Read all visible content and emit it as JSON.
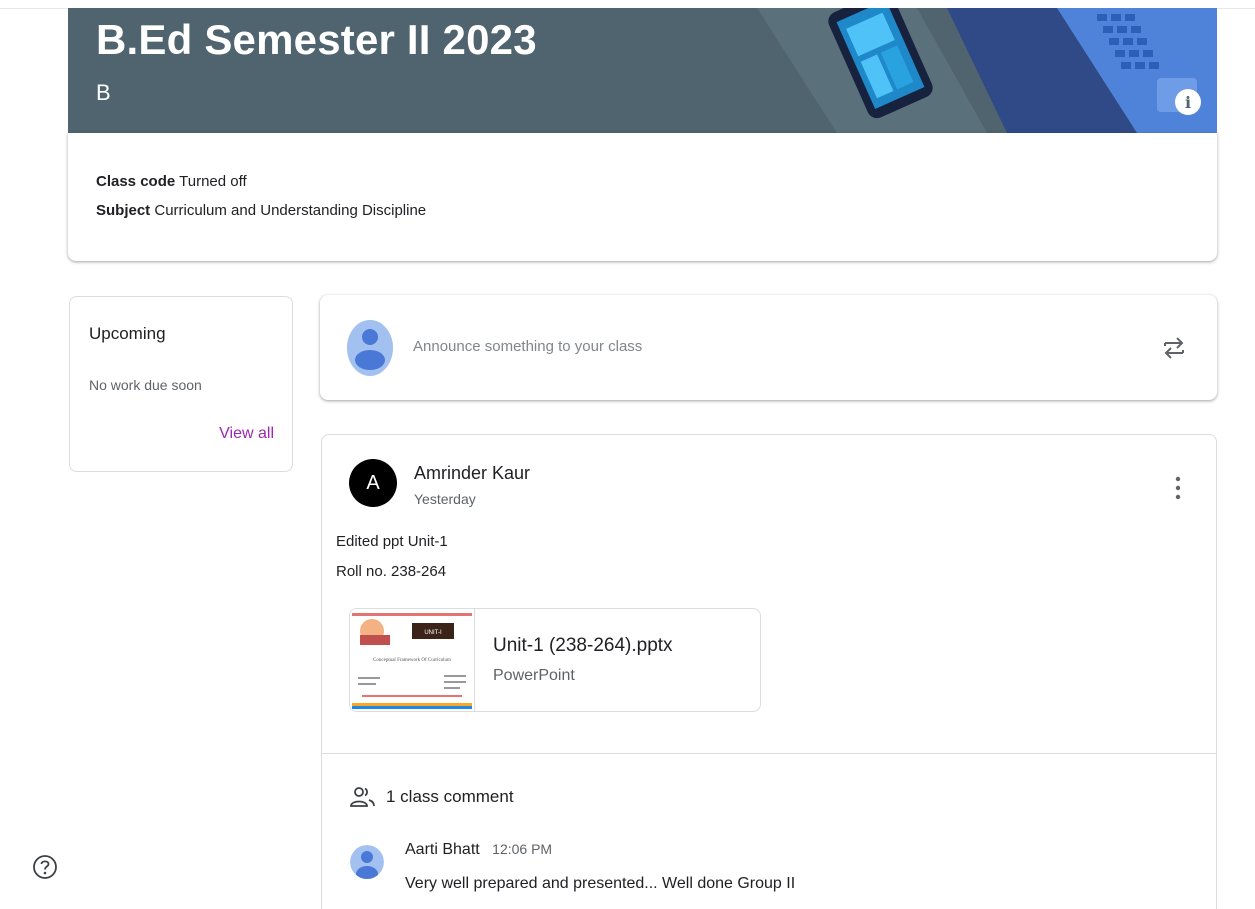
{
  "banner": {
    "title": "B.Ed Semester II 2023",
    "section": "B",
    "info_icon": "info-icon",
    "color": "#4f646f"
  },
  "class_info": {
    "code_label": "Class code",
    "code_value": "Turned off",
    "subject_label": "Subject",
    "subject_value": "Curriculum and Understanding Discipline"
  },
  "upcoming": {
    "title": "Upcoming",
    "empty_text": "No work due soon",
    "view_all": "View all",
    "link_color": "#9c27b0"
  },
  "announce": {
    "placeholder": "Announce something to your class",
    "repost_icon": "repost-icon"
  },
  "post": {
    "author_initial": "A",
    "author": "Amrinder Kaur",
    "time": "Yesterday",
    "lines": [
      "Edited ppt Unit-1",
      "Roll no. 238-264"
    ],
    "attachment": {
      "name": "Unit-1 (238-264).pptx",
      "type": "PowerPoint",
      "thumb_badge": "UNIT-I",
      "thumb_caption": "Conceptual Framework Of Curriculum"
    },
    "comment_count": "1 class comment",
    "comment": {
      "author": "Aarti Bhatt",
      "time": "12:06 PM",
      "text": "Very well prepared and presented... Well done Group II"
    }
  },
  "help_icon": "help-icon"
}
